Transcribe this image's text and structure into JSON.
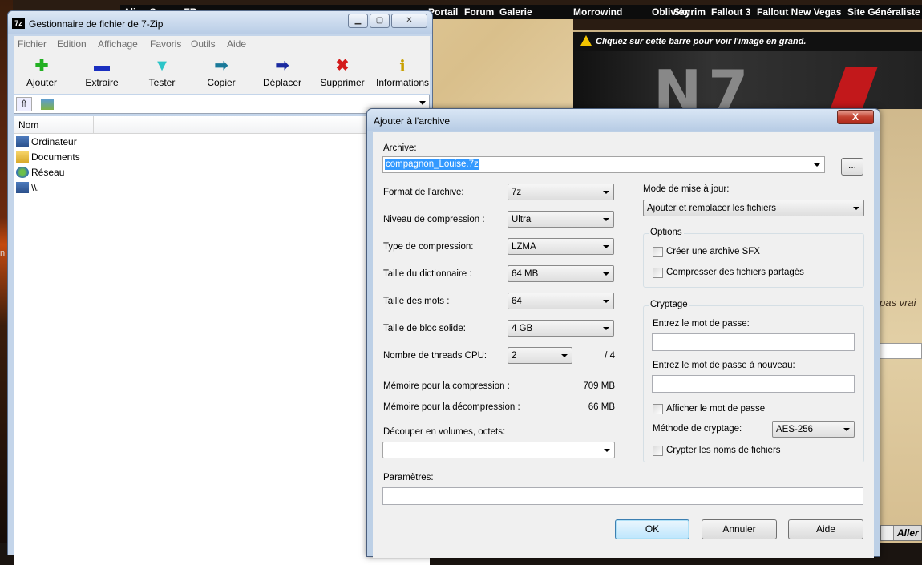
{
  "background": {
    "nav_links": [
      "Alien Swarm FR",
      "Portail",
      "Forum",
      "Galerie",
      "Morrowind",
      "Oblivion",
      "Skyrim",
      "Fallout 3",
      "Fallout New Vegas",
      "Site Généraliste"
    ],
    "image_bar_text": "Cliquez sur cette barre pour voir l'image en grand.",
    "banner_logo_text": "N7",
    "side_text": "pas vrai",
    "edge_letter": "n",
    "aller_label": "Aller"
  },
  "zip": {
    "title": "Gestionnaire de fichier de 7-Zip",
    "app_icon_text": "7z",
    "menu": [
      "Fichier",
      "Edition",
      "Affichage",
      "Favoris",
      "Outils",
      "Aide"
    ],
    "toolbar": [
      {
        "label": "Ajouter",
        "icon": "plus-icon",
        "glyph": "✚",
        "color": "#22b022"
      },
      {
        "label": "Extraire",
        "icon": "minus-icon",
        "glyph": "▬",
        "color": "#1a2fc0"
      },
      {
        "label": "Tester",
        "icon": "check-icon",
        "glyph": "▼",
        "color": "#2cc5c8"
      },
      {
        "label": "Copier",
        "icon": "copy-arrow-icon",
        "glyph": "➡",
        "color": "#1a7a9a"
      },
      {
        "label": "Déplacer",
        "icon": "move-arrow-icon",
        "glyph": "➡",
        "color": "#1a2aa0"
      },
      {
        "label": "Supprimer",
        "icon": "delete-icon",
        "glyph": "✖",
        "color": "#d41a1a"
      },
      {
        "label": "Informations",
        "icon": "info-icon",
        "glyph": "i",
        "color": "#c8a000"
      }
    ],
    "column_name": "Nom",
    "items": [
      {
        "label": "Ordinateur",
        "icon": "computer-icon"
      },
      {
        "label": "Documents",
        "icon": "folder-icon"
      },
      {
        "label": "Réseau",
        "icon": "network-icon"
      },
      {
        "label": "\\\\.",
        "icon": "computer-icon"
      }
    ]
  },
  "dialog": {
    "title": "Ajouter à l'archive",
    "close_label": "X",
    "archive_label": "Archive:",
    "archive_value": "compagnon_Louise.7z",
    "browse_label": "...",
    "left": [
      {
        "label": "Format de l'archive:",
        "value": "7z"
      },
      {
        "label": "Niveau de compression :",
        "value": "Ultra"
      },
      {
        "label": "Type de compression:",
        "value": "LZMA"
      },
      {
        "label": "Taille du dictionnaire :",
        "value": "64 MB"
      },
      {
        "label": "Taille des mots :",
        "value": "64"
      },
      {
        "label": "Taille de bloc solide:",
        "value": "4 GB"
      }
    ],
    "threads_label": "Nombre de threads CPU:",
    "threads_value": "2",
    "threads_max": "/ 4",
    "mem_comp_label": "Mémoire pour la compression :",
    "mem_comp_value": "709 MB",
    "mem_decomp_label": "Mémoire pour la décompression :",
    "mem_decomp_value": "66 MB",
    "split_label": "Découper en volumes, octets:",
    "split_value": "",
    "params_label": "Paramètres:",
    "params_value": "",
    "update_mode_label": "Mode de mise à jour:",
    "update_mode_value": "Ajouter et remplacer les fichiers",
    "options_title": "Options",
    "opt_sfx": "Créer une archive SFX",
    "opt_shared": "Compresser des fichiers partagés",
    "crypto_title": "Cryptage",
    "pwd_label": "Entrez le mot de passe:",
    "pwd2_label": "Entrez le mot de passe à nouveau:",
    "show_pwd": "Afficher le mot de passe",
    "crypto_method_label": "Méthode de cryptage:",
    "crypto_method_value": "AES-256",
    "encrypt_names": "Crypter les noms de fichiers",
    "ok_label": "OK",
    "cancel_label": "Annuler",
    "help_label": "Aide"
  }
}
